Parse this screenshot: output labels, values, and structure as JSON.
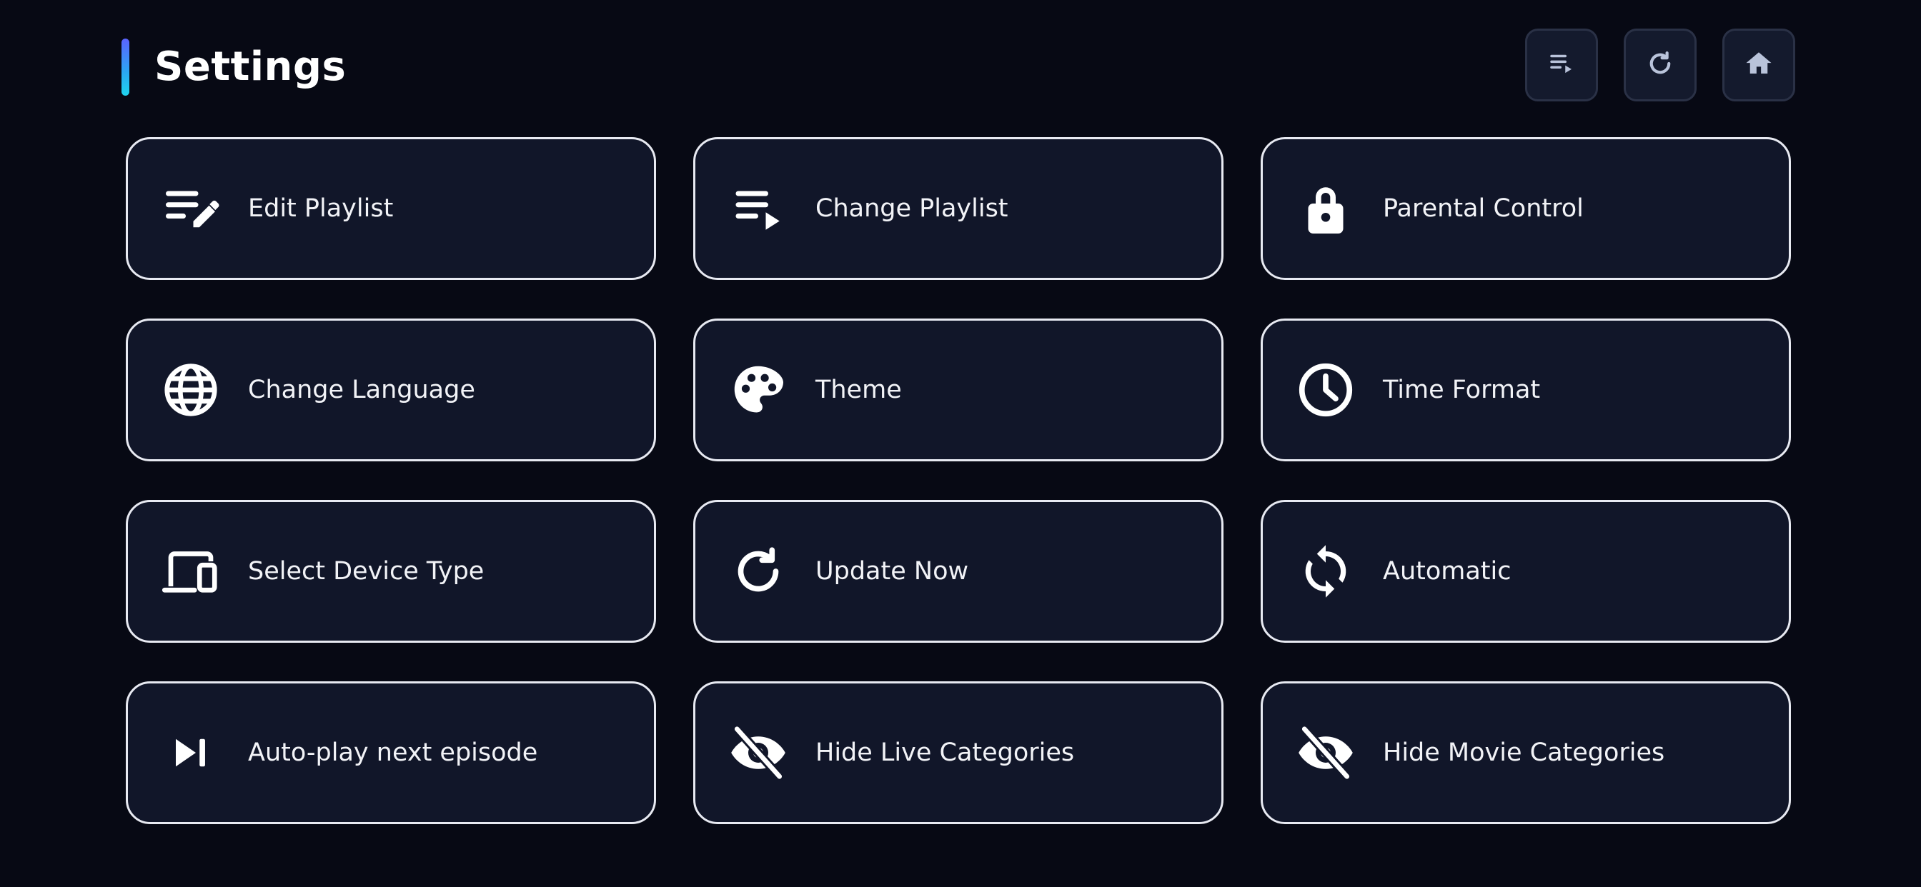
{
  "header": {
    "title": "Settings",
    "actions": [
      {
        "icon": "playlist-play-icon"
      },
      {
        "icon": "refresh-icon"
      },
      {
        "icon": "home-icon"
      }
    ]
  },
  "settings": {
    "items": [
      {
        "label": "Edit Playlist",
        "icon": "playlist-edit-icon"
      },
      {
        "label": "Change Playlist",
        "icon": "playlist-play-icon"
      },
      {
        "label": "Parental Control",
        "icon": "lock-icon"
      },
      {
        "label": "Change Language",
        "icon": "globe-icon"
      },
      {
        "label": "Theme",
        "icon": "palette-icon"
      },
      {
        "label": "Time Format",
        "icon": "clock-icon"
      },
      {
        "label": "Select Device Type",
        "icon": "devices-icon"
      },
      {
        "label": "Update Now",
        "icon": "refresh-icon"
      },
      {
        "label": "Automatic",
        "icon": "sync-icon"
      },
      {
        "label": "Auto-play next episode",
        "icon": "skip-next-icon"
      },
      {
        "label": "Hide Live Categories",
        "icon": "eye-off-icon"
      },
      {
        "label": "Hide Movie Categories",
        "icon": "eye-off-icon"
      }
    ]
  },
  "colors": {
    "background": "#070914",
    "card_background": "#111629",
    "card_border": "#e8eaf2",
    "header_button_background": "#141a2d",
    "header_icon": "#b9c3da",
    "accent_gradient_start": "#5b63ff",
    "accent_gradient_end": "#1fd4ee"
  }
}
